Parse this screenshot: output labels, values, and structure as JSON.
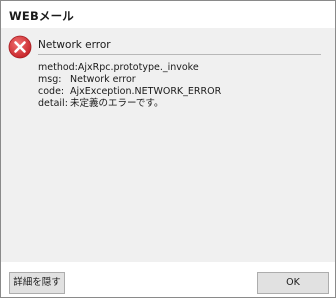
{
  "window": {
    "title": "WEBメール"
  },
  "message": {
    "icon": "error-icon",
    "heading": "Network error",
    "method_line": "method:AjxRpc.prototype._invoke",
    "rows": [
      {
        "key": "msg:",
        "value": "Network error"
      },
      {
        "key": "code:",
        "value": "AjxException.NETWORK_ERROR"
      },
      {
        "key": "detail:",
        "value": "未定義のエラーです。"
      }
    ]
  },
  "buttons": {
    "details_label": "詳細を隠す",
    "ok_label": "OK"
  },
  "colors": {
    "error_red": "#d93a3a",
    "content_bg": "#f0f0f0"
  }
}
